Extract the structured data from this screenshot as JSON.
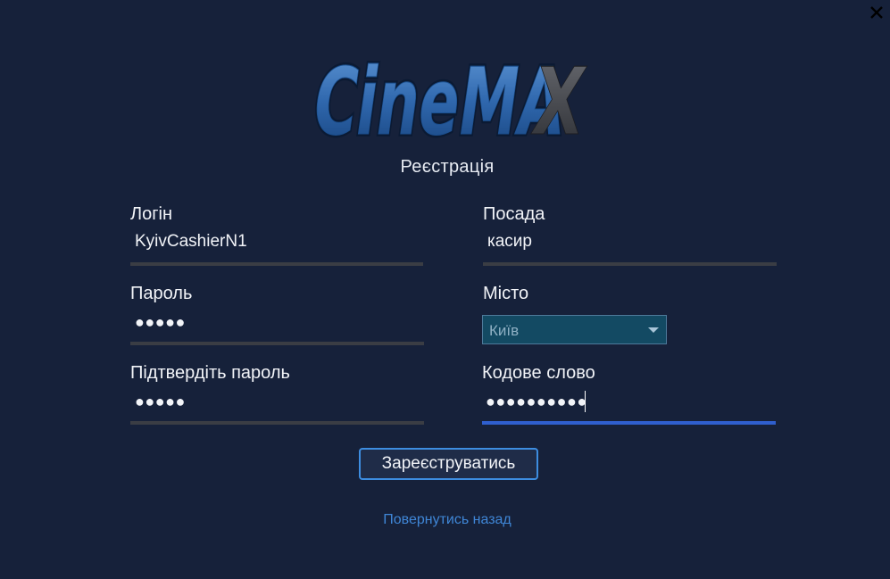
{
  "app": {
    "logo_text": "CineMAX"
  },
  "page": {
    "title": "Реєстрація"
  },
  "form": {
    "login": {
      "label": "Логін",
      "value": "KyivCashierN1"
    },
    "position": {
      "label": "Посада",
      "value": "касир"
    },
    "password": {
      "label": "Пароль",
      "value": "●●●●●"
    },
    "city": {
      "label": "Місто",
      "selected": "Київ"
    },
    "confirm_password": {
      "label": "Підтвердіть пароль",
      "value": "●●●●●"
    },
    "code_word": {
      "label": "Кодове слово",
      "value": "●●●●●●●●●●"
    }
  },
  "actions": {
    "register_label": "Зареєструватись",
    "back_label": "Повернутись назад"
  },
  "icons": {
    "close": "close-icon",
    "dropdown": "chevron-down-icon"
  },
  "colors": {
    "background": "#16213a",
    "focus_underline": "#2f5fce",
    "link": "#3f86d6",
    "button_border": "#3d8de0"
  }
}
